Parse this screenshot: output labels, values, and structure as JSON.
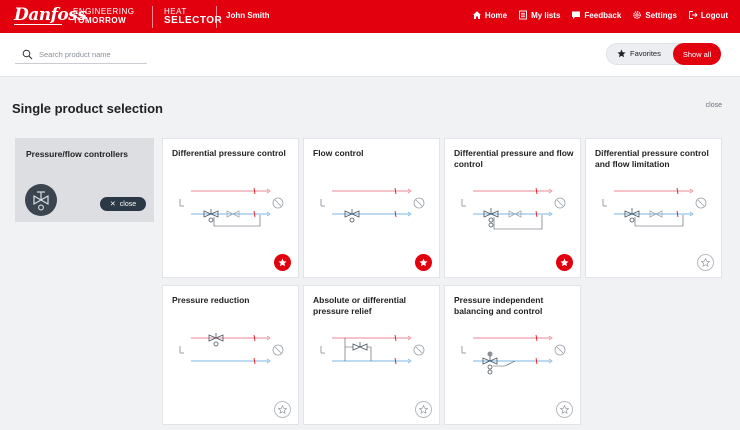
{
  "header": {
    "logo": "Danfoss",
    "tagline_line1": "ENGINEERING",
    "tagline_line2": "TOMORROW",
    "app_line1": "HEAT",
    "app_line2": "SELECTOR",
    "user_name": "John Smith",
    "nav": {
      "home": "Home",
      "my_lists": "My lists",
      "feedback": "Feedback",
      "settings": "Settings",
      "logout": "Logout"
    }
  },
  "search": {
    "placeholder": "Search product name",
    "value": ""
  },
  "filter": {
    "favorites_label": "Favorites",
    "show_all_label": "Show all",
    "active": "Show all"
  },
  "page": {
    "title": "Single product selection",
    "close_label": "close"
  },
  "category": {
    "label": "Pressure/flow controllers",
    "close_label": "close",
    "icon": "valve-icon"
  },
  "products": [
    {
      "title": "Differential pressure control",
      "favorite": true
    },
    {
      "title": "Flow control",
      "favorite": true
    },
    {
      "title": "Differential pressure and flow control",
      "favorite": true
    },
    {
      "title": "Differential pressure control and flow limitation",
      "favorite": false
    },
    {
      "title": "Pressure reduction",
      "favorite": false
    },
    {
      "title": "Absolute or differential pressure relief",
      "favorite": false
    },
    {
      "title": "Pressure independent balancing and control",
      "favorite": false
    }
  ],
  "colors": {
    "brand_red": "#e2000f",
    "dark_navy": "#2b3846",
    "supply_line": "#e88a95",
    "return_line": "#7ab6e3"
  }
}
